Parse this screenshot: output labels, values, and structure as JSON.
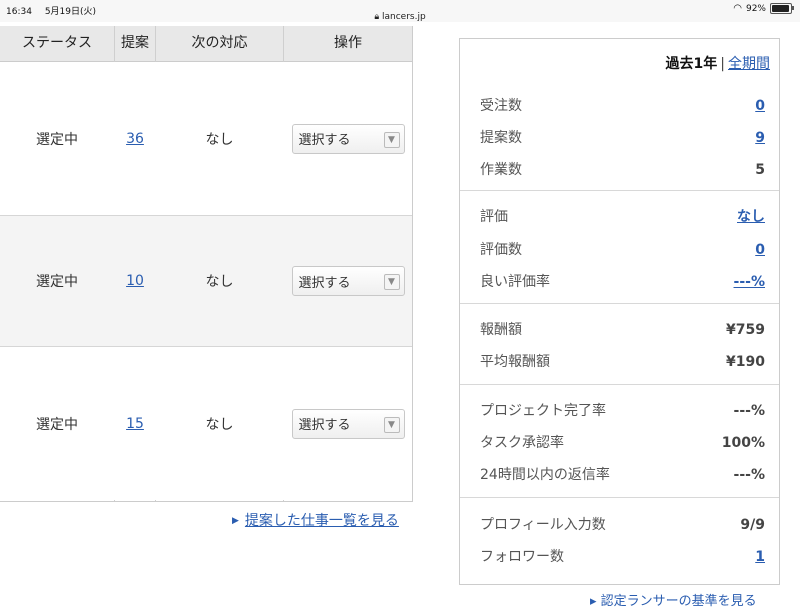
{
  "statusbar": {
    "time": "16:34",
    "date": "5月19日(火)",
    "url": "lancers.jp",
    "battery": "92%",
    "battery_level": 0.92
  },
  "table": {
    "headers": [
      "ステータス",
      "提案",
      "次の対応",
      "操作"
    ],
    "rows": [
      {
        "status": "選定中",
        "proposals": "36",
        "next": "なし",
        "action": "選択する"
      },
      {
        "status": "選定中",
        "proposals": "10",
        "next": "なし",
        "action": "選択する"
      },
      {
        "status": "選定中",
        "proposals": "15",
        "next": "なし",
        "action": "選択する"
      }
    ],
    "view_list_link": "提案した仕事一覧を見る"
  },
  "stats": {
    "period_current": "過去1年",
    "period_separator": "|",
    "period_all": "全期間",
    "groups": [
      [
        {
          "label": "受注数",
          "value": "0",
          "link": true
        },
        {
          "label": "提案数",
          "value": "9",
          "link": true
        },
        {
          "label": "作業数",
          "value": "5",
          "link": false
        }
      ],
      [
        {
          "label": "評価",
          "value": "なし",
          "link": true
        },
        {
          "label": "評価数",
          "value": "0",
          "link": true
        },
        {
          "label": "良い評価率",
          "value": "---%",
          "link": true
        }
      ],
      [
        {
          "label": "報酬額",
          "value": "¥759",
          "link": false
        },
        {
          "label": "平均報酬額",
          "value": "¥190",
          "link": false
        }
      ],
      [
        {
          "label": "プロジェクト完了率",
          "value": "---%",
          "link": false
        },
        {
          "label": "タスク承認率",
          "value": "100%",
          "link": false
        },
        {
          "label": "24時間以内の返信率",
          "value": "---%",
          "link": false
        }
      ],
      [
        {
          "label": "プロフィール入力数",
          "value": "9/9",
          "link": false
        },
        {
          "label": "フォロワー数",
          "value": "1",
          "link": true
        }
      ]
    ],
    "bottom_link_partial": "▸ 認定ランサーの基準を見る"
  },
  "colors": {
    "link": "#2a5db0",
    "header_bg": "#e8e8e8",
    "alt_row_bg": "#f4f4f4"
  }
}
